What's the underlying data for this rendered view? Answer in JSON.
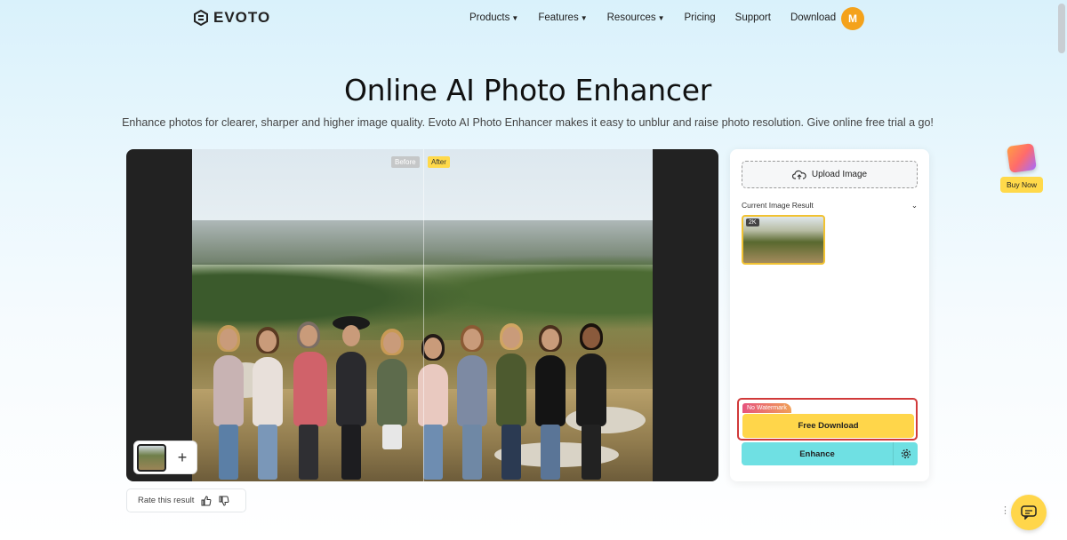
{
  "brand": {
    "name": "EVOTO"
  },
  "nav": {
    "items": [
      {
        "label": "Products",
        "caret": true
      },
      {
        "label": "Features",
        "caret": true
      },
      {
        "label": "Resources",
        "caret": true
      },
      {
        "label": "Pricing",
        "caret": false
      },
      {
        "label": "Support",
        "caret": false
      },
      {
        "label": "Download",
        "caret": false
      }
    ],
    "avatar": "M"
  },
  "hero": {
    "title": "Online AI Photo Enhancer",
    "subtitle": "Enhance photos for clearer, sharper and higher image quality. Evoto AI Photo Enhancer makes it easy to unblur and raise photo resolution. Give online free trial a go!"
  },
  "viewer": {
    "before_tag": "Before",
    "after_tag": "After"
  },
  "rate": {
    "label": "Rate this result"
  },
  "panel": {
    "upload_label": "Upload Image",
    "current_result_label": "Current Image Result",
    "resolution_badge": "2K",
    "no_watermark": "No Watermark",
    "free_download": "Free Download",
    "enhance": "Enhance"
  },
  "promo": {
    "buy_now": "Buy Now"
  },
  "colors": {
    "accent_yellow": "#ffd64a",
    "accent_cyan": "#6fe0e3",
    "highlight_red": "#d13a3a",
    "avatar_orange": "#f4a21b"
  }
}
